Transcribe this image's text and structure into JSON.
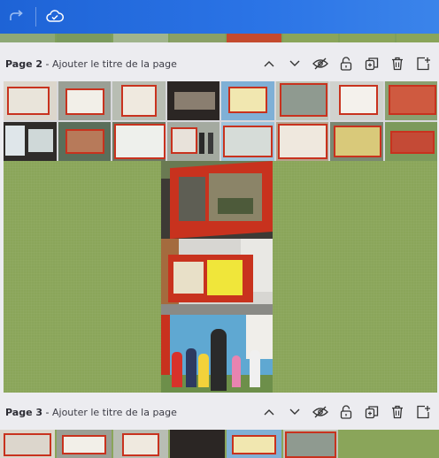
{
  "toolbar": {
    "redo_icon": "redo-arrow-icon",
    "saved_icon": "cloud-check-icon"
  },
  "page2": {
    "number": "Page 2",
    "separator": " - ",
    "title_placeholder": "Ajouter le titre de la page"
  },
  "page3": {
    "number": "Page 3",
    "separator": " - ",
    "title_placeholder": "Ajouter le titre de la page"
  },
  "page_actions": [
    "chevron-up-icon",
    "chevron-down-icon",
    "hide-eye-icon",
    "lock-icon",
    "duplicate-icon",
    "trash-icon",
    "add-page-icon"
  ],
  "colors": {
    "topbar": "#2b74e6",
    "page_bg": "#8aa55a",
    "booth_red": "#c8321e"
  }
}
